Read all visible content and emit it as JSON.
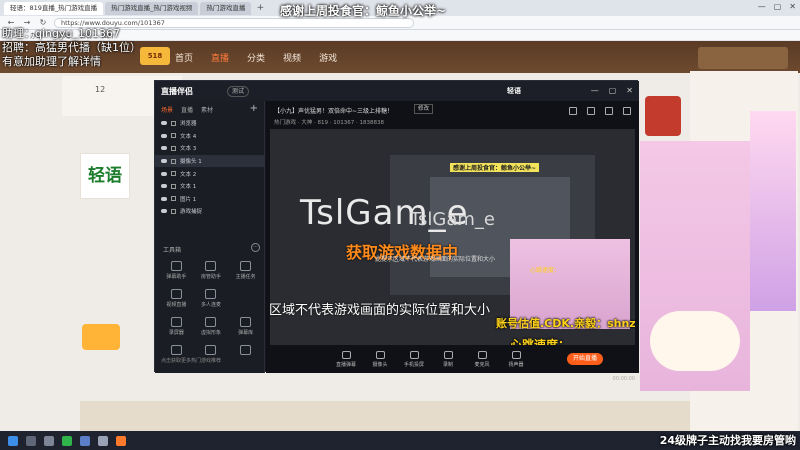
{
  "browser": {
    "tabs": [
      "轻语：819直播_热门游戏直播",
      "热门游戏直播_热门游戏视频",
      "热门游戏直播"
    ],
    "url": "https://www.douyu.com/101367",
    "bookmarks": [
      "办公",
      "小游戏",
      "影视",
      "图片"
    ]
  },
  "site": {
    "nav": [
      "首页",
      "直播",
      "分类",
      "视频",
      "游戏"
    ],
    "logo_badge": "518",
    "room_count": "12",
    "streamer_logo": "轻语"
  },
  "overlay": {
    "assistant": "助理：qingyu_101367",
    "recruit": "招聘：高猛男代播（缺1位）",
    "contact": "有意加助理了解详情",
    "thanks": "感谢上周投食官：鲸鱼小公举~",
    "taskbar_promo": "24级牌子主动找我要房管哟"
  },
  "obs": {
    "app_name": "直播伴侣",
    "badge": "测试",
    "tab_label": "轻语",
    "left_tabs": [
      "场景",
      "直播",
      "素材"
    ],
    "sources": [
      "浏览器",
      "文本 4",
      "文本 3",
      "摄像头 1",
      "文本 2",
      "文本 1",
      "图片 1",
      "游戏捕捉"
    ],
    "tools_label": "工具箱",
    "tools": [
      "弹幕助手",
      "房管助手",
      "主播任务",
      "视频直播",
      "多人连麦",
      "",
      "录屏器",
      "虚拟形象",
      "弹幕库",
      "",
      "",
      ""
    ],
    "hint": "点击获取更多热门游戏推荐",
    "room_title": "【小九】声优猛男！双倍命中~三级上排糖！",
    "room_tag": "修改",
    "room_meta": "热门游戏 · 大神  ·  819 · 101367  ·  1838838",
    "preview": {
      "banner": "感谢上周投食官：鲸鱼小公举~",
      "tsl_big": "TslGam_e",
      "tsl_small": "TslGam_e",
      "fetching": "获取游戏数据中",
      "tiny_hint": "此提示区域不代表游戏画面的实际位置和大小",
      "disclaimer": "此提示区域不代表游戏画面的实际位置和大小",
      "value_line": "账号估值.CDK.亲毅：shnzty",
      "heartbeat": "心跳速度：",
      "hb_tag": "心跳速度："
    },
    "bottom_buttons": [
      "直播弹幕",
      "摄像头",
      "手机投屏",
      "录制",
      "麦克风",
      "扬声器"
    ],
    "start_live": "开始直播",
    "time": "00:00:00"
  }
}
